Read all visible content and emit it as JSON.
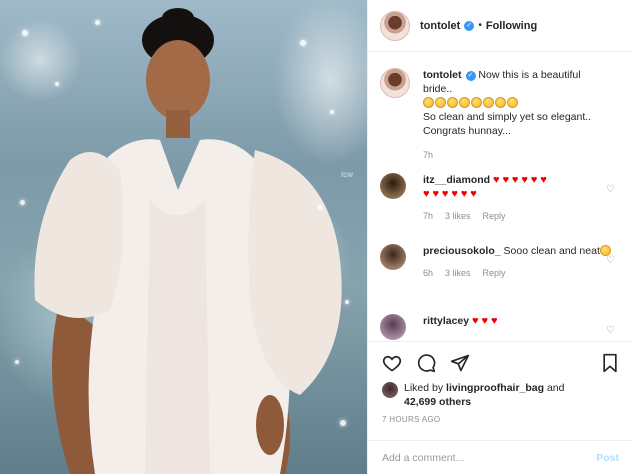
{
  "post": {
    "username": "tontolet",
    "following_label": "Following",
    "dot": "•",
    "watermark": "tcw"
  },
  "caption": {
    "username": "tontolet",
    "text_line1": "Now this is a beautiful",
    "text_line2": "bride..",
    "emoji_count": 8,
    "text_line3": "So clean and simply yet so elegant..",
    "text_line4": "Congrats hunnay...",
    "time": "7h"
  },
  "comments": [
    {
      "username": "itz__diamond",
      "text": "",
      "hearts": 12,
      "time": "7h",
      "likes": "3 likes",
      "reply": "Reply"
    },
    {
      "username": "preciousokolo_",
      "text": "Sooo clean and neat",
      "time": "6h",
      "likes": "3 likes",
      "reply": "Reply"
    },
    {
      "username": "rittylacey",
      "text": "",
      "hearts": 3
    }
  ],
  "likes": {
    "prefix": "Liked by",
    "user": "livingproofhair_bag",
    "and": "and",
    "count": "42,699 others"
  },
  "timestamp": "7 HOURS AGO",
  "add_comment": {
    "placeholder": "Add a comment...",
    "post_label": "Post"
  },
  "colors": {
    "heart": "#ee0000",
    "verified": "#3897f0",
    "post_disabled": "#b2dffc"
  }
}
